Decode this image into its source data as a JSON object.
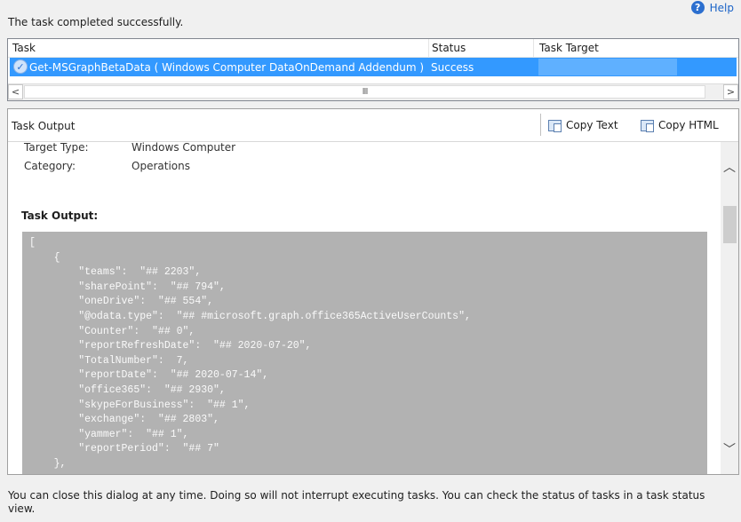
{
  "status_message": "The task completed successfully.",
  "help": {
    "label": "Help",
    "icon": "help-icon"
  },
  "task_grid": {
    "columns": [
      "Task",
      "Status",
      "Task Target"
    ],
    "rows": [
      {
        "task": "Get-MSGraphBetaData ( Windows Computer DataOnDemand Addendum )",
        "status": "Success",
        "target": ""
      }
    ],
    "scroll_left": "<",
    "scroll_right": ">",
    "scroll_grip": "III"
  },
  "output_panel": {
    "title": "Task Output",
    "copy_text": "Copy Text",
    "copy_html": "Copy HTML",
    "fields": [
      {
        "label": "Target Type:",
        "value": "Windows Computer"
      },
      {
        "label": "Category:",
        "value": "Operations"
      }
    ],
    "task_output_label": "Task Output:",
    "code_lines": [
      "[",
      "    {",
      "        \"teams\":  \"## 2203\",",
      "        \"sharePoint\":  \"## 794\",",
      "        \"oneDrive\":  \"## 554\",",
      "        \"@odata.type\":  \"## #microsoft.graph.office365ActiveUserCounts\",",
      "        \"Counter\":  \"## 0\",",
      "        \"reportRefreshDate\":  \"## 2020-07-20\",",
      "        \"TotalNumber\":  7,",
      "        \"reportDate\":  \"## 2020-07-14\",",
      "        \"office365\":  \"## 2930\",",
      "        \"skypeForBusiness\":  \"## 1\",",
      "        \"exchange\":  \"## 2803\",",
      "        \"yammer\":  \"## 1\",",
      "        \"reportPeriod\":  \"## 7\"",
      "    },"
    ]
  },
  "footer_text": "You can close this dialog at any time. Doing so will not interrupt executing tasks. You can check the status of tasks in a task status view."
}
